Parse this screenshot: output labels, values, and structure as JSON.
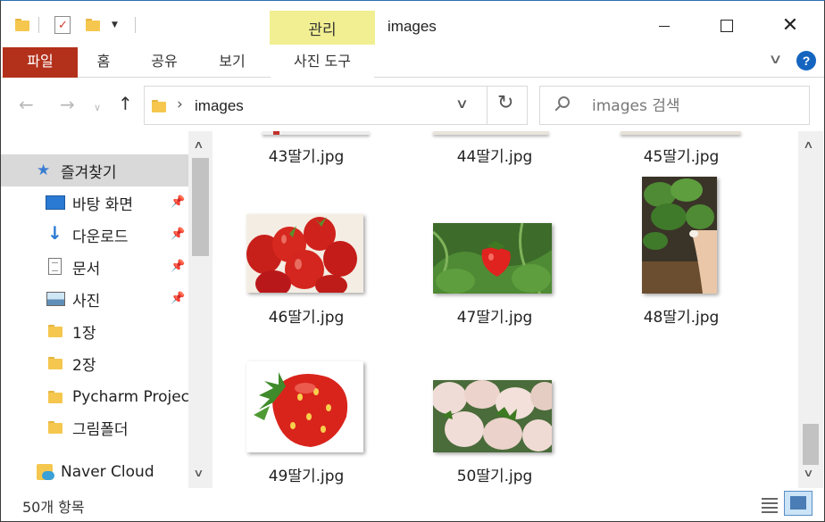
{
  "window": {
    "title": "images"
  },
  "ribbon": {
    "contextual_tab": "관리",
    "tabs": [
      "파일",
      "홈",
      "공유",
      "보기",
      "사진 도구"
    ]
  },
  "address": {
    "path_segment": "images"
  },
  "search": {
    "placeholder": "images 검색"
  },
  "nav": {
    "quick_access": "즐겨찾기",
    "items": [
      {
        "label": "바탕 화면",
        "icon": "desktop-icon",
        "pinned": true
      },
      {
        "label": "다운로드",
        "icon": "download-icon",
        "pinned": true
      },
      {
        "label": "문서",
        "icon": "document-icon",
        "pinned": true
      },
      {
        "label": "사진",
        "icon": "pictures-icon",
        "pinned": true
      },
      {
        "label": "1장",
        "icon": "folder-icon",
        "pinned": false
      },
      {
        "label": "2장",
        "icon": "folder-icon",
        "pinned": false
      },
      {
        "label": "Pycharm Project",
        "icon": "folder-icon",
        "pinned": false
      },
      {
        "label": "그림폴더",
        "icon": "folder-icon",
        "pinned": false
      }
    ],
    "naver_cloud": "Naver Cloud"
  },
  "files": [
    {
      "name": "43딸기.jpg"
    },
    {
      "name": "44딸기.jpg"
    },
    {
      "name": "45딸기.jpg"
    },
    {
      "name": "46딸기.jpg"
    },
    {
      "name": "47딸기.jpg"
    },
    {
      "name": "48딸기.jpg"
    },
    {
      "name": "49딸기.jpg"
    },
    {
      "name": "50딸기.jpg"
    }
  ],
  "status": {
    "item_count": "50개 항목"
  },
  "colors": {
    "file_tab": "#b3301b",
    "manage_tab": "#f1ef92",
    "selection": "#d9d9d9",
    "accent": "#2a79d2"
  }
}
